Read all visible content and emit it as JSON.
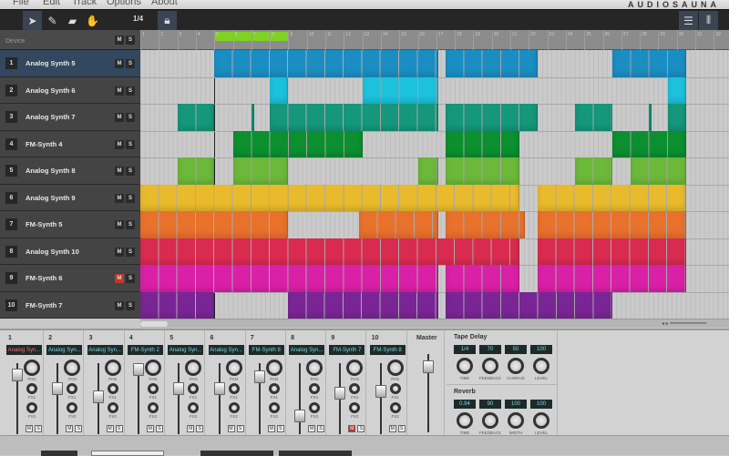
{
  "menu": [
    "File",
    "Edit",
    "Track",
    "Options",
    "About"
  ],
  "brand": "AUDIOSAUNA",
  "toolbar": {
    "tools": [
      "pointer-icon",
      "pencil-icon",
      "eraser-icon",
      "hand-icon"
    ],
    "quantize": "1/4",
    "lock": "lock-icon",
    "views": [
      "list-view-icon",
      "mixer-view-icon"
    ]
  },
  "track_header": {
    "label": "Device",
    "mute": "M",
    "solo": "S"
  },
  "ruler": {
    "bars": [
      "1",
      "2",
      "3",
      "4",
      "5",
      "6",
      "7",
      "8",
      "9",
      "10",
      "11",
      "12",
      "13",
      "14",
      "15",
      "16",
      "17",
      "18",
      "19",
      "20",
      "21",
      "22",
      "23",
      "24",
      "25",
      "26",
      "27",
      "28",
      "29",
      "30",
      "31",
      "32"
    ],
    "loop": [
      4,
      8
    ]
  },
  "playhead_bar": 4,
  "tracks": [
    {
      "num": "1",
      "name": "Analog Synth 5",
      "color": "#1a8ec3",
      "selected": true,
      "muted": false,
      "clips": [
        [
          4,
          16.1
        ],
        [
          16.5,
          21.5
        ],
        [
          25.5,
          29.5
        ]
      ]
    },
    {
      "num": "2",
      "name": "Analog Synth 6",
      "color": "#1cc1dc",
      "muted": false,
      "clips": [
        [
          7,
          8
        ],
        [
          12,
          16.1
        ],
        [
          28.5,
          29.5
        ]
      ]
    },
    {
      "num": "3",
      "name": "Analog Synth 7",
      "color": "#14977a",
      "muted": false,
      "clips": [
        [
          2,
          4
        ],
        [
          6,
          6.15
        ],
        [
          7,
          16.1
        ],
        [
          16.5,
          21.5
        ],
        [
          23.5,
          25.5
        ],
        [
          27.5,
          27.65
        ],
        [
          28.5,
          29.5
        ]
      ]
    },
    {
      "num": "4",
      "name": "FM-Synth 4",
      "color": "#0b8f2f",
      "muted": false,
      "clips": [
        [
          5,
          12
        ],
        [
          16.5,
          20.5
        ],
        [
          25.5,
          29.5
        ]
      ]
    },
    {
      "num": "5",
      "name": "Analog Synth 8",
      "color": "#6cb83a",
      "muted": false,
      "clips": [
        [
          2,
          4
        ],
        [
          5,
          8
        ],
        [
          15,
          16.1
        ],
        [
          16.5,
          20.5
        ],
        [
          23.5,
          25.5
        ],
        [
          26.5,
          29.5
        ]
      ]
    },
    {
      "num": "6",
      "name": "Analog Synth 9",
      "color": "#e9ba2c",
      "muted": false,
      "clips": [
        [
          0,
          20.5
        ],
        [
          21.5,
          29.5
        ]
      ]
    },
    {
      "num": "7",
      "name": "FM-Synth 5",
      "color": "#e8712c",
      "muted": false,
      "clips": [
        [
          0,
          8
        ],
        [
          11.8,
          16.1
        ],
        [
          16.5,
          20.8
        ],
        [
          21.5,
          29.5
        ]
      ]
    },
    {
      "num": "8",
      "name": "Analog Synth 10",
      "color": "#d92b4f",
      "muted": false,
      "clips": [
        [
          0,
          20.5
        ],
        [
          21.5,
          29.5
        ]
      ]
    },
    {
      "num": "9",
      "name": "FM-Synth 6",
      "color": "#d920a6",
      "muted": true,
      "clips": [
        [
          0,
          16.1
        ],
        [
          16.5,
          20.5
        ],
        [
          21.5,
          29.5
        ]
      ]
    },
    {
      "num": "10",
      "name": "FM-Synth 7",
      "color": "#7a2596",
      "muted": false,
      "clips": [
        [
          0,
          4
        ],
        [
          8,
          16.1
        ],
        [
          16.5,
          25.5
        ]
      ]
    }
  ],
  "mixer": {
    "knob_labels": {
      "pan": "PAN",
      "fx1": "FX1",
      "fx2": "FX2"
    },
    "channels": [
      {
        "num": "1",
        "name": "Analog Syn...",
        "level": 0.9,
        "muted": false,
        "highlight": true
      },
      {
        "num": "2",
        "name": "Analog Syn...",
        "level": 0.67,
        "muted": false
      },
      {
        "num": "3",
        "name": "Analog Syn...",
        "level": 0.53,
        "muted": false
      },
      {
        "num": "4",
        "name": "FM-Synth 2",
        "level": 1.0,
        "muted": false
      },
      {
        "num": "5",
        "name": "Analog Syn...",
        "level": 0.67,
        "muted": false
      },
      {
        "num": "6",
        "name": "Analog Syn...",
        "level": 0.67,
        "muted": false
      },
      {
        "num": "7",
        "name": "FM-Synth 8",
        "level": 0.87,
        "muted": false
      },
      {
        "num": "8",
        "name": "Analog Syn...",
        "level": 0.2,
        "muted": false
      },
      {
        "num": "9",
        "name": "FM-Synth 7",
        "level": 0.6,
        "muted": true
      },
      {
        "num": "10",
        "name": "FM-Synth 8",
        "level": 0.63,
        "muted": false
      }
    ],
    "master": {
      "label": "Master",
      "level": 0.9
    }
  },
  "effects": [
    {
      "title": "Tape Delay",
      "params": [
        {
          "value": "1/4",
          "label": "TIME"
        },
        {
          "value": "70",
          "label": "FEEDBACK"
        },
        {
          "value": "50",
          "label": "CHORUS"
        },
        {
          "value": "100",
          "label": "LEVEL"
        }
      ]
    },
    {
      "title": "Reverb",
      "params": [
        {
          "value": "0.94",
          "label": "TIME"
        },
        {
          "value": "90",
          "label": "FEEDBACK"
        },
        {
          "value": "100",
          "label": "WIDTH"
        },
        {
          "value": "100",
          "label": "LEVEL"
        }
      ]
    }
  ]
}
